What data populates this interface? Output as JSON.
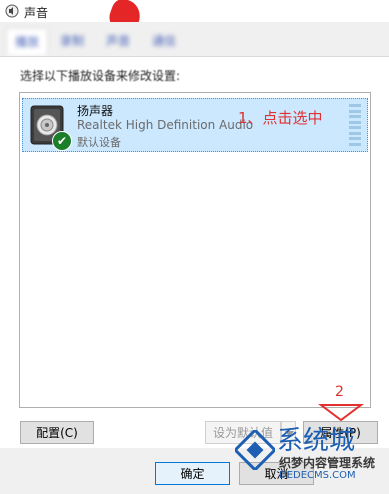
{
  "window": {
    "title": "声音"
  },
  "tabs": [
    {
      "label": "播放"
    },
    {
      "label": "录制"
    },
    {
      "label": "声音"
    },
    {
      "label": "通信"
    }
  ],
  "instruction": "选择以下播放设备来修改设置:",
  "devices": [
    {
      "name": "扬声器",
      "description": "Realtek High Definition Audio",
      "status": "默认设备",
      "icon": "speaker-icon",
      "selected": true
    }
  ],
  "annotations": {
    "step1": "1、点击选中",
    "step2": "2",
    "color": "#e03030"
  },
  "buttons": {
    "configure": "配置(C)",
    "set_default": "设为默认值(S)",
    "properties": "属性(P)",
    "ok": "确定",
    "cancel": "取消"
  },
  "watermark": {
    "title": "系统城",
    "subtitle": "织梦内容管理系统",
    "url": "DEDECMS.COM"
  },
  "colors": {
    "selection": "#cce8ff",
    "annotation": "#e03030",
    "watermark_blue": "#1d5fb3"
  }
}
